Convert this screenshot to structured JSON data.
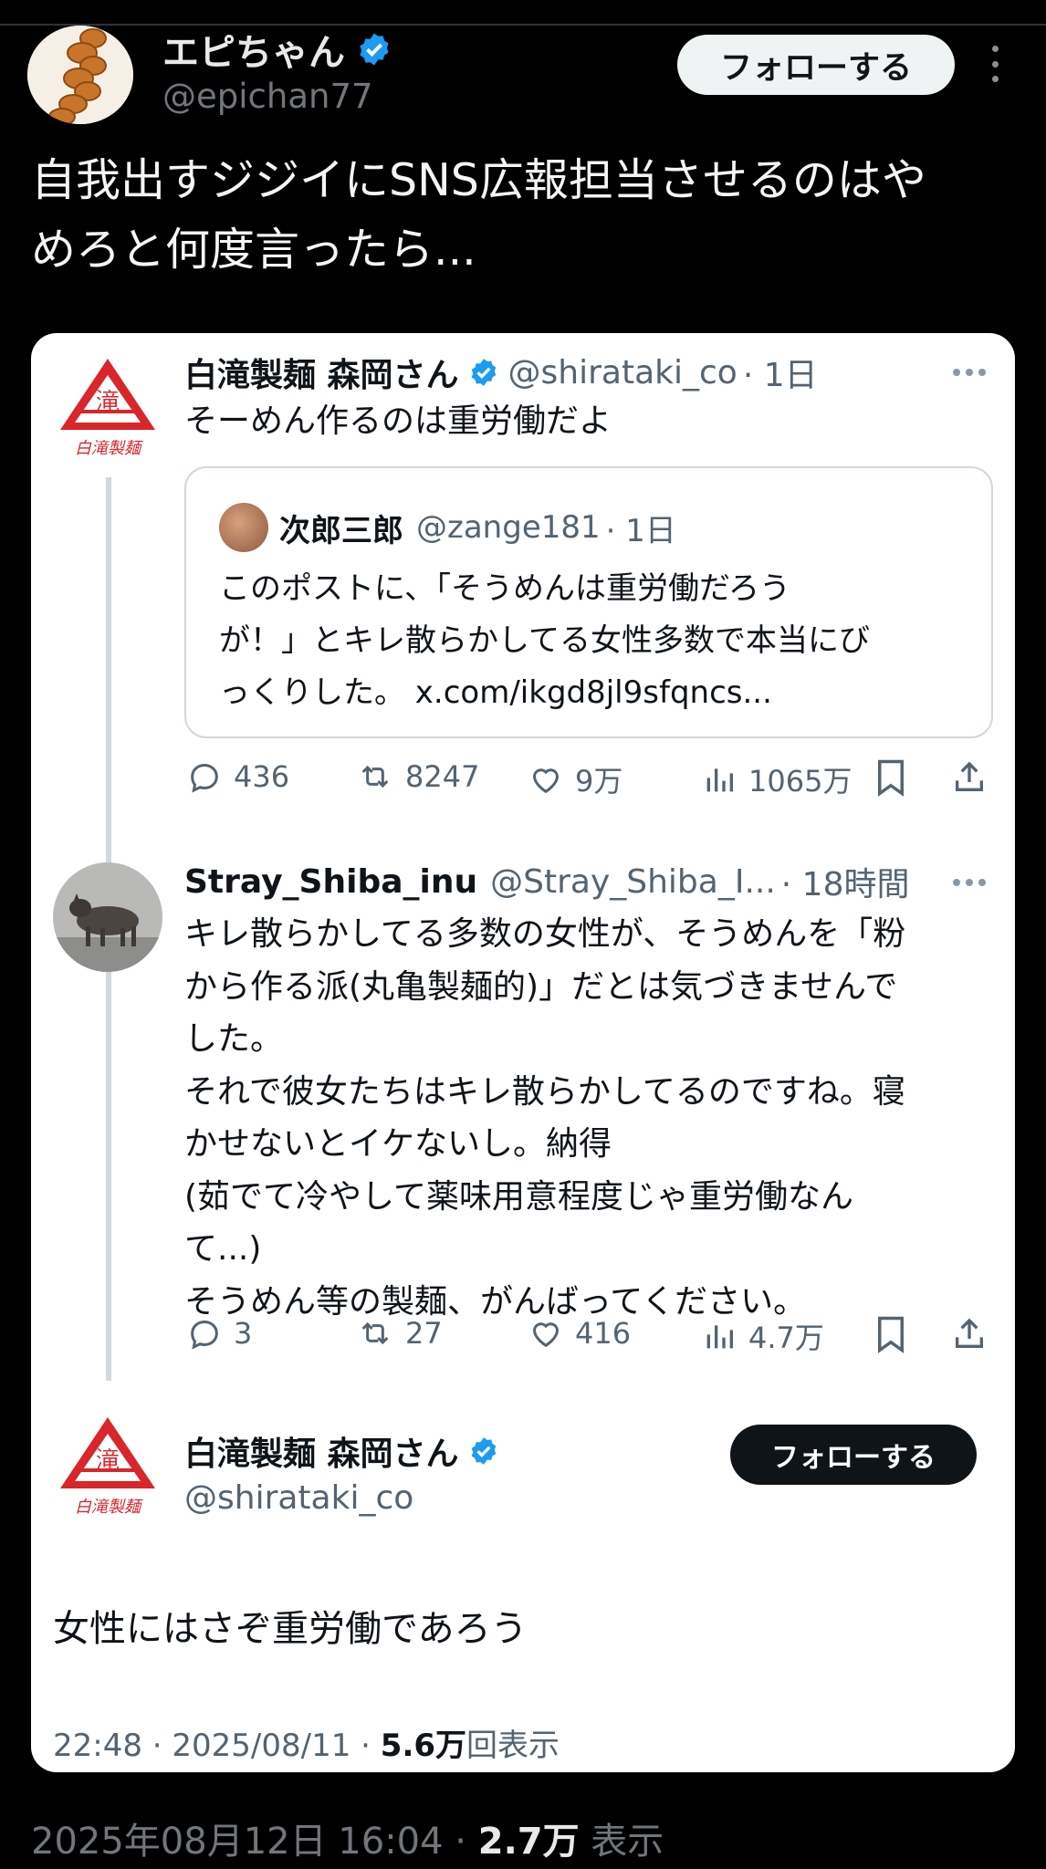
{
  "outer": {
    "name": "エピちゃん",
    "handle": "@epichan77",
    "follow_label": "フォローする",
    "text_line1": "自我出すジジイにSNS広報担当させるのはや",
    "text_line2": "めろと何度言ったら..."
  },
  "card": {
    "tweet1": {
      "name": "白滝製麺 森岡さん",
      "handle": "@shirataki_co",
      "time": "· 1日",
      "text": "そーめん作るのは重労働だよ",
      "quote": {
        "name": "次郎三郎",
        "handle": "@zange181",
        "time": "· 1日",
        "line1": "このポストに、「そうめんは重労働だろう",
        "line2": "が！」とキレ散らかしてる女性多数で本当にび",
        "line3": "っくりした。 x.com/ikgd8jl9sfqncs..."
      },
      "actions": {
        "replies": "436",
        "reposts": "8247",
        "likes": "9万",
        "views": "1065万"
      }
    },
    "tweet2": {
      "name": "Stray_Shiba_inu",
      "handle": "@Stray_Shiba_I...",
      "time": "· 18時間",
      "lines": [
        "キレ散らかしてる多数の女性が、そうめんを「粉",
        "から作る派(丸亀製麺的)」だとは気づきませんで",
        "した。",
        "それで彼女たちはキレ散らかしてるのですね。寝",
        "かせないとイケないし。納得",
        "(茹でて冷やして薬味用意程度じゃ重労働なん",
        "て...)",
        "そうめん等の製麺、がんばってください。"
      ],
      "actions": {
        "replies": "3",
        "reposts": "27",
        "likes": "416",
        "views": "4.7万"
      }
    },
    "tweet3": {
      "name": "白滝製麺 森岡さん",
      "handle": "@shirataki_co",
      "follow_label": "フォローする",
      "text": "女性にはさぞ重労働であろう",
      "meta_time": "22:48 · 2025/08/11 · ",
      "meta_count": "5.6万",
      "meta_suffix": "回表示"
    },
    "logo_char": "滝",
    "logo_caption": "白滝製麺"
  },
  "footer": {
    "datetime": "2025年08月12日 16:04 · ",
    "count": "2.7万",
    "suffix": " 表示"
  },
  "colors": {
    "verified": "#1d9bf0",
    "logo_red": "#d8262b"
  },
  "icons": [
    "verified-badge-icon",
    "kebab-menu-icon",
    "more-icon",
    "reply-icon",
    "repost-icon",
    "like-icon",
    "views-icon",
    "bookmark-icon",
    "share-icon"
  ]
}
